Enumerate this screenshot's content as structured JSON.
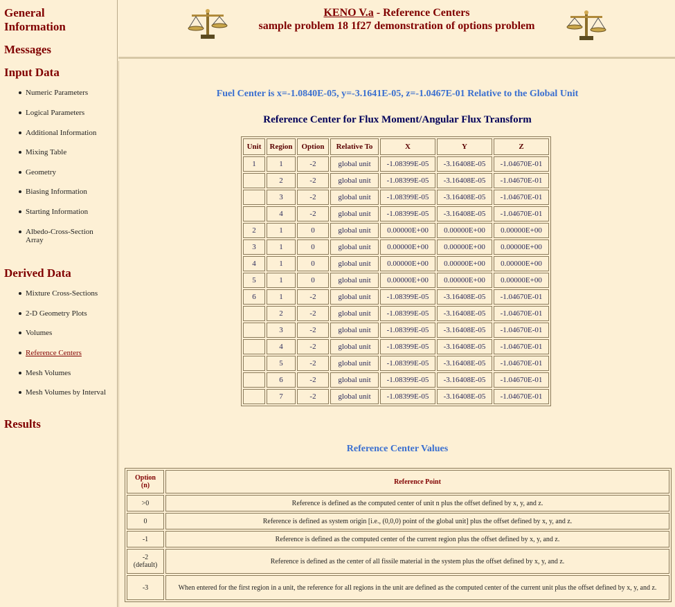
{
  "sidebar": {
    "general": "General Information",
    "messages": "Messages",
    "input_data": "Input Data",
    "input_items": [
      {
        "label": "Numeric Parameters"
      },
      {
        "label": "Logical Parameters"
      },
      {
        "label": "Additional Information"
      },
      {
        "label": "Mixing Table"
      },
      {
        "label": "Geometry"
      },
      {
        "label": "Biasing Information"
      },
      {
        "label": "Starting Information"
      },
      {
        "label": "Albedo-Cross-Section Array"
      }
    ],
    "derived_data": "Derived Data",
    "derived_items": [
      {
        "label": "Mixture Cross-Sections"
      },
      {
        "label": "2-D Geometry Plots"
      },
      {
        "label": "Volumes"
      },
      {
        "label": "Reference Centers"
      },
      {
        "label": "Mesh Volumes"
      },
      {
        "label": "Mesh Volumes by Interval"
      }
    ],
    "results": "Results"
  },
  "header": {
    "title_link": "KENO V.a",
    "title_rest": " - Reference Centers",
    "subtitle": "sample problem 18 1f27 demonstration of options problem"
  },
  "main": {
    "fuel_center": "Fuel Center is x=-1.0840E-05, y=-3.1641E-05, z=-1.0467E-01 Relative to the Global Unit",
    "table_title": "Reference Center for Flux Moment/Angular Flux Transform",
    "columns": [
      "Unit",
      "Region",
      "Option",
      "Relative To",
      "X",
      "Y",
      "Z"
    ],
    "rows": [
      [
        "1",
        "1",
        "-2",
        "global unit",
        "-1.08399E-05",
        "-3.16408E-05",
        "-1.04670E-01"
      ],
      [
        "",
        "2",
        "-2",
        "global unit",
        "-1.08399E-05",
        "-3.16408E-05",
        "-1.04670E-01"
      ],
      [
        "",
        "3",
        "-2",
        "global unit",
        "-1.08399E-05",
        "-3.16408E-05",
        "-1.04670E-01"
      ],
      [
        "",
        "4",
        "-2",
        "global unit",
        "-1.08399E-05",
        "-3.16408E-05",
        "-1.04670E-01"
      ],
      [
        "2",
        "1",
        "0",
        "global unit",
        "0.00000E+00",
        "0.00000E+00",
        "0.00000E+00"
      ],
      [
        "3",
        "1",
        "0",
        "global unit",
        "0.00000E+00",
        "0.00000E+00",
        "0.00000E+00"
      ],
      [
        "4",
        "1",
        "0",
        "global unit",
        "0.00000E+00",
        "0.00000E+00",
        "0.00000E+00"
      ],
      [
        "5",
        "1",
        "0",
        "global unit",
        "0.00000E+00",
        "0.00000E+00",
        "0.00000E+00"
      ],
      [
        "6",
        "1",
        "-2",
        "global unit",
        "-1.08399E-05",
        "-3.16408E-05",
        "-1.04670E-01"
      ],
      [
        "",
        "2",
        "-2",
        "global unit",
        "-1.08399E-05",
        "-3.16408E-05",
        "-1.04670E-01"
      ],
      [
        "",
        "3",
        "-2",
        "global unit",
        "-1.08399E-05",
        "-3.16408E-05",
        "-1.04670E-01"
      ],
      [
        "",
        "4",
        "-2",
        "global unit",
        "-1.08399E-05",
        "-3.16408E-05",
        "-1.04670E-01"
      ],
      [
        "",
        "5",
        "-2",
        "global unit",
        "-1.08399E-05",
        "-3.16408E-05",
        "-1.04670E-01"
      ],
      [
        "",
        "6",
        "-2",
        "global unit",
        "-1.08399E-05",
        "-3.16408E-05",
        "-1.04670E-01"
      ],
      [
        "",
        "7",
        "-2",
        "global unit",
        "-1.08399E-05",
        "-3.16408E-05",
        "-1.04670E-01"
      ]
    ],
    "values_title": "Reference Center Values",
    "option_header": "Option (n)",
    "point_header": "Reference Point",
    "options": [
      {
        "opt": ">0",
        "desc": "Reference is defined as the computed center of unit n plus the offset defined by x, y, and z."
      },
      {
        "opt": "0",
        "desc": "Reference is defined as system origin [i.e., (0,0,0) point of the global unit] plus the offset defined by x, y, and z."
      },
      {
        "opt": "-1",
        "desc": "Reference is defined as the computed center of the current region plus the offset defined by x, y, and z."
      },
      {
        "opt": "-2 (default)",
        "desc": "Reference is defined as the center of all fissile material in the system plus the offset defined by x, y, and z."
      },
      {
        "opt": "-3",
        "desc": "When entered for the first region in a unit, the reference for all regions in the unit are defined as the computed center of the current unit plus the offset defined by x, y, and z."
      }
    ]
  },
  "colors": {
    "background": "#fdf0d5",
    "heading": "#800000",
    "accent_blue": "#3a6fd0",
    "navy": "#00005a"
  }
}
